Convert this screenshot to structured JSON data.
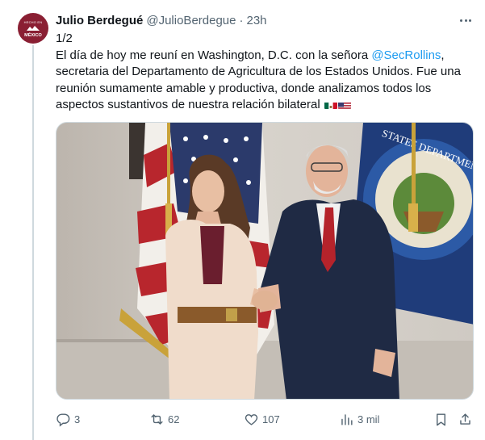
{
  "author": {
    "name": "Julio Berdegué",
    "handle": "@JulioBerdegue",
    "time": "23h",
    "avatar_text_top": "HECHO EN",
    "avatar_text_bottom": "MÉXICO"
  },
  "tweet": {
    "thread_marker": "1/2",
    "text_part1": "El día de hoy me reuní en Washington, D.C. con la señora ",
    "mention": "@SecRollins",
    "text_part2": ", secretaria del Departamento de Agricultura de los Estados Unidos. Fue una reunión sumamente amable y productiva, donde analizamos todos los aspectos sustantivos de nuestra relación bilateral ",
    "flags": [
      "mexico-flag-icon",
      "us-flag-icon"
    ]
  },
  "photo": {
    "seal_text": "STATES DEPARTMENT AGRICULTU"
  },
  "actions": {
    "replies": "3",
    "retweets": "62",
    "likes": "107",
    "views": "3 mil"
  },
  "colors": {
    "text": "#0f1419",
    "secondary": "#536471",
    "link": "#1d9bf0",
    "avatar_bg": "#8a1f33"
  }
}
